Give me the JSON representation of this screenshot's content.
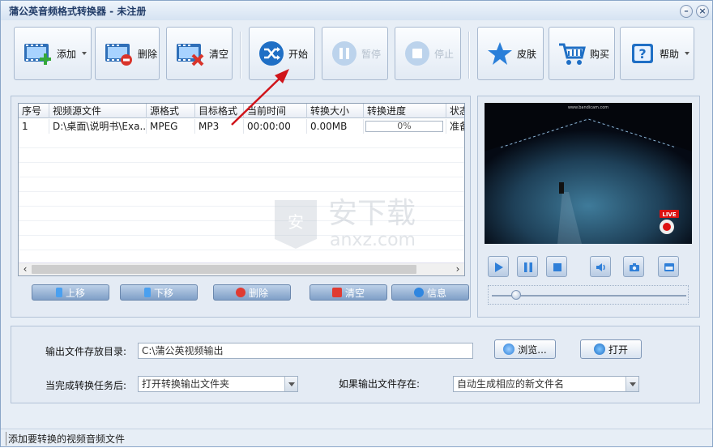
{
  "window": {
    "title": "蒲公英音频格式转换器 - 未注册",
    "min_symbol": "–",
    "close_symbol": "×"
  },
  "toolbar": {
    "add_label": "添加",
    "delete_label": "删除",
    "clear_label": "清空",
    "start_label": "开始",
    "pause_label": "暂停",
    "stop_label": "停止",
    "skin_label": "皮肤",
    "buy_label": "购买",
    "help_label": "帮助"
  },
  "table": {
    "columns": [
      "序号",
      "视频源文件",
      "源格式",
      "目标格式",
      "当前时间",
      "转换大小",
      "转换进度",
      "状态"
    ],
    "rows": [
      {
        "index": "1",
        "source": "D:\\桌面\\说明书\\Exa...",
        "src_format": "MPEG",
        "dst_format": "MP3",
        "time": "00:00:00",
        "size": "0.00MB",
        "progress": "0%",
        "progress_value": 0,
        "status": "准备"
      }
    ]
  },
  "list_buttons": {
    "up": "上移",
    "down": "下移",
    "delete": "删除",
    "clear": "清空",
    "info": "信息"
  },
  "player": {
    "video_caption": "www.bandicam.com",
    "live_badge": "LIVE",
    "seek_position": 0.1
  },
  "output": {
    "dir_label": "输出文件存放目录:",
    "dir_value": "C:\\蒲公英视频输出",
    "browse_label": "浏览...",
    "open_label": "打开",
    "after_label": "当完成转换任务后:",
    "after_value": "打开转换输出文件夹",
    "exists_label": "如果输出文件存在:",
    "exists_value": "自动生成相应的新文件名"
  },
  "status": {
    "text": "添加要转换的视频音频文件"
  },
  "watermark": {
    "text": "安下载",
    "url": "anxz.com"
  },
  "colors": {
    "accent": "#3a7bd5",
    "disabled": "#b4bfcc",
    "arrow": "#d0141a"
  }
}
